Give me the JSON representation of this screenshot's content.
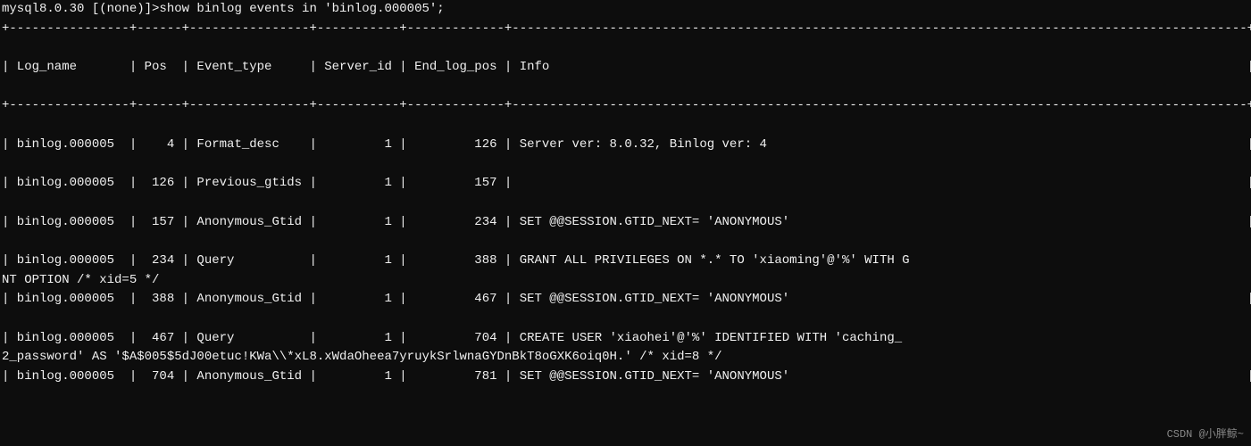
{
  "terminal": {
    "lines": [
      {
        "id": "cmd-line",
        "text": "mysql8.0.30 [(none)]>show binlog events in 'binlog.000005';"
      },
      {
        "id": "sep1",
        "text": "+----------------+------+----------------+-----------+-------------+--------------------------------------------------------------------------------------------------+"
      },
      {
        "id": "sep2",
        "text": "                                                                                                                                                                                                          |"
      },
      {
        "id": "header",
        "text": "| Log_name       | Pos  | Event_type     | Server_id | End_log_pos | Info                                                                                             |"
      },
      {
        "id": "sep3",
        "text": "                                                                                                                                                                                                          |"
      },
      {
        "id": "sep4",
        "text": "+----------------+------+----------------+-----------+-------------+--------------------------------------------------------------------------------------------------+"
      },
      {
        "id": "sep5",
        "text": "                                                                                                                                                                                                          |"
      },
      {
        "id": "row1",
        "text": "| binlog.000005  |    4 | Format_desc    |         1 |         126 | Server ver: 8.0.32, Binlog ver: 4                                                                |"
      },
      {
        "id": "sep6",
        "text": "                                                                                                                                                                                                          |"
      },
      {
        "id": "row2",
        "text": "| binlog.000005  |  126 | Previous_gtids |         1 |         157 |                                                                                                  |"
      },
      {
        "id": "sep7",
        "text": "                                                                                                                                                                                                          |"
      },
      {
        "id": "row3",
        "text": "| binlog.000005  |  157 | Anonymous_Gtid |         1 |         234 | SET @@SESSION.GTID_NEXT= 'ANONYMOUS'                                                             |"
      },
      {
        "id": "sep8",
        "text": "                                                                                                                                                                                                          |"
      },
      {
        "id": "row4a",
        "text": "| binlog.000005  |  234 | Query          |         1 |         388 | GRANT ALL PRIVILEGES ON *.* TO 'xiaoming'@'%' WITH G"
      },
      {
        "id": "row4b",
        "text": "NT OPTION /* xid=5 */                                                                                                                                                                                     |"
      },
      {
        "id": "row5",
        "text": "| binlog.000005  |  388 | Anonymous_Gtid |         1 |         467 | SET @@SESSION.GTID_NEXT= 'ANONYMOUS'                                                             |"
      },
      {
        "id": "sep9",
        "text": "                                                                                                                                                                                                          |"
      },
      {
        "id": "row6a",
        "text": "| binlog.000005  |  467 | Query          |         1 |         704 | CREATE USER 'xiaohei'@'%' IDENTIFIED WITH 'caching_"
      },
      {
        "id": "row6b",
        "text": "2_password' AS '$A$005$5dJ00etuc!KWa\\\\*xL8.xWdaOheea7yruykSrlwnaGYDnBkT8oGXK6oiq0H.' /* xid=8 */                                                                                                        |"
      },
      {
        "id": "row7",
        "text": "| binlog.000005  |  704 | Anonymous_Gtid |         1 |         781 | SET @@SESSION.GTID_NEXT= 'ANONYMOUS'                                                             |"
      }
    ],
    "watermark": "CSDN @小胖鲸~"
  }
}
